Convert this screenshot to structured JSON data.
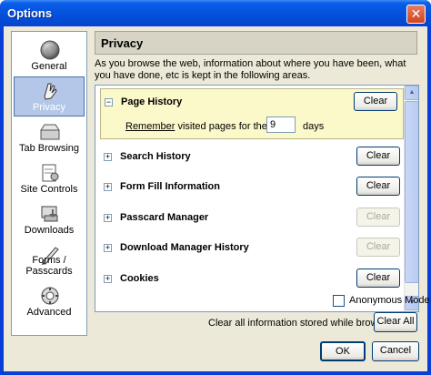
{
  "window": {
    "title": "Options",
    "close_symbol": "✕"
  },
  "sidebar": {
    "items": [
      {
        "label": "General",
        "icon": "general-icon"
      },
      {
        "label": "Privacy",
        "icon": "privacy-icon",
        "selected": true
      },
      {
        "label": "Tab Browsing",
        "icon": "tab-browsing-icon"
      },
      {
        "label": "Site Controls",
        "icon": "site-controls-icon"
      },
      {
        "label": "Downloads",
        "icon": "downloads-icon"
      },
      {
        "label": "Forms / Passcards",
        "icon": "forms-passcards-icon"
      },
      {
        "label": "Advanced",
        "icon": "advanced-icon"
      }
    ]
  },
  "panel": {
    "title": "Privacy",
    "description": "As you browse the web, information about where you have been, what you have done, etc is kept in the following areas."
  },
  "sections": [
    {
      "name": "Page History",
      "toggle": "−",
      "clear_label": "Clear",
      "enabled": true,
      "expanded": true,
      "remember_label_prefix": "Remember",
      "remember_label_rest": " visited pages for the last",
      "days_value": "9",
      "days_label": "days"
    },
    {
      "name": "Search History",
      "toggle": "+",
      "clear_label": "Clear",
      "enabled": true
    },
    {
      "name": "Form Fill Information",
      "toggle": "+",
      "clear_label": "Clear",
      "enabled": true
    },
    {
      "name": "Passcard Manager",
      "toggle": "+",
      "clear_label": "Clear",
      "enabled": false
    },
    {
      "name": "Download Manager History",
      "toggle": "+",
      "clear_label": "Clear",
      "enabled": false
    },
    {
      "name": "Cookies",
      "toggle": "+",
      "clear_label": "Clear",
      "enabled": true
    }
  ],
  "anonymous_mode": {
    "label": "Anonymous Mode",
    "checked": false
  },
  "clear_all": {
    "label": "Clear all information stored while browsing:",
    "button_label": "Clear All"
  },
  "dialog_buttons": {
    "ok_label": "OK",
    "cancel_label": "Cancel"
  },
  "colors": {
    "titlebar": "#0553e0",
    "panel_bg": "#ece9d8",
    "selected_item": "#b5c7e8",
    "expanded_bg": "#fbf8c9"
  }
}
